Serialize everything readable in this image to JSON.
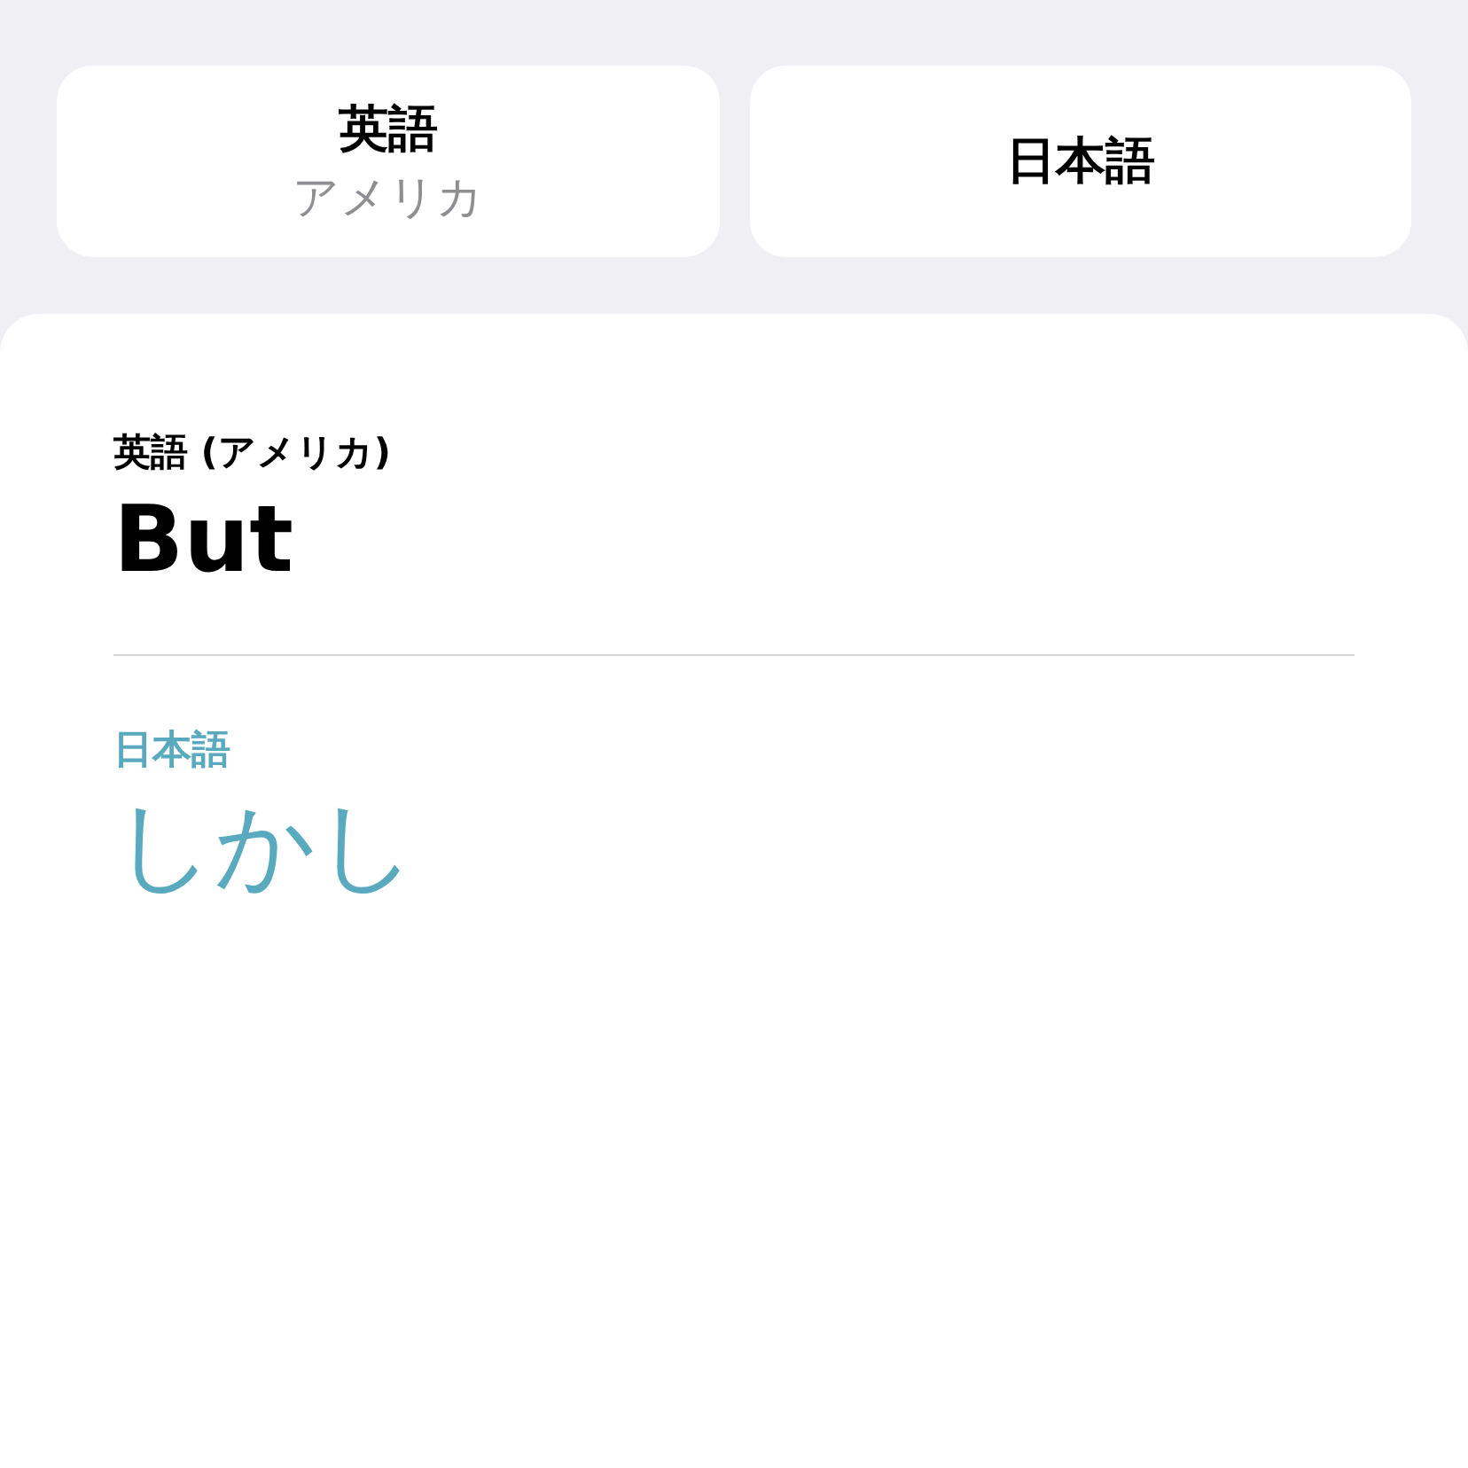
{
  "language_buttons": [
    {
      "name": "英語",
      "region": "アメリカ"
    },
    {
      "name": "日本語"
    }
  ],
  "translation": {
    "source": {
      "label": "英語 (アメリカ)",
      "text": "But"
    },
    "target": {
      "label": "日本語",
      "text": "しかし"
    }
  }
}
